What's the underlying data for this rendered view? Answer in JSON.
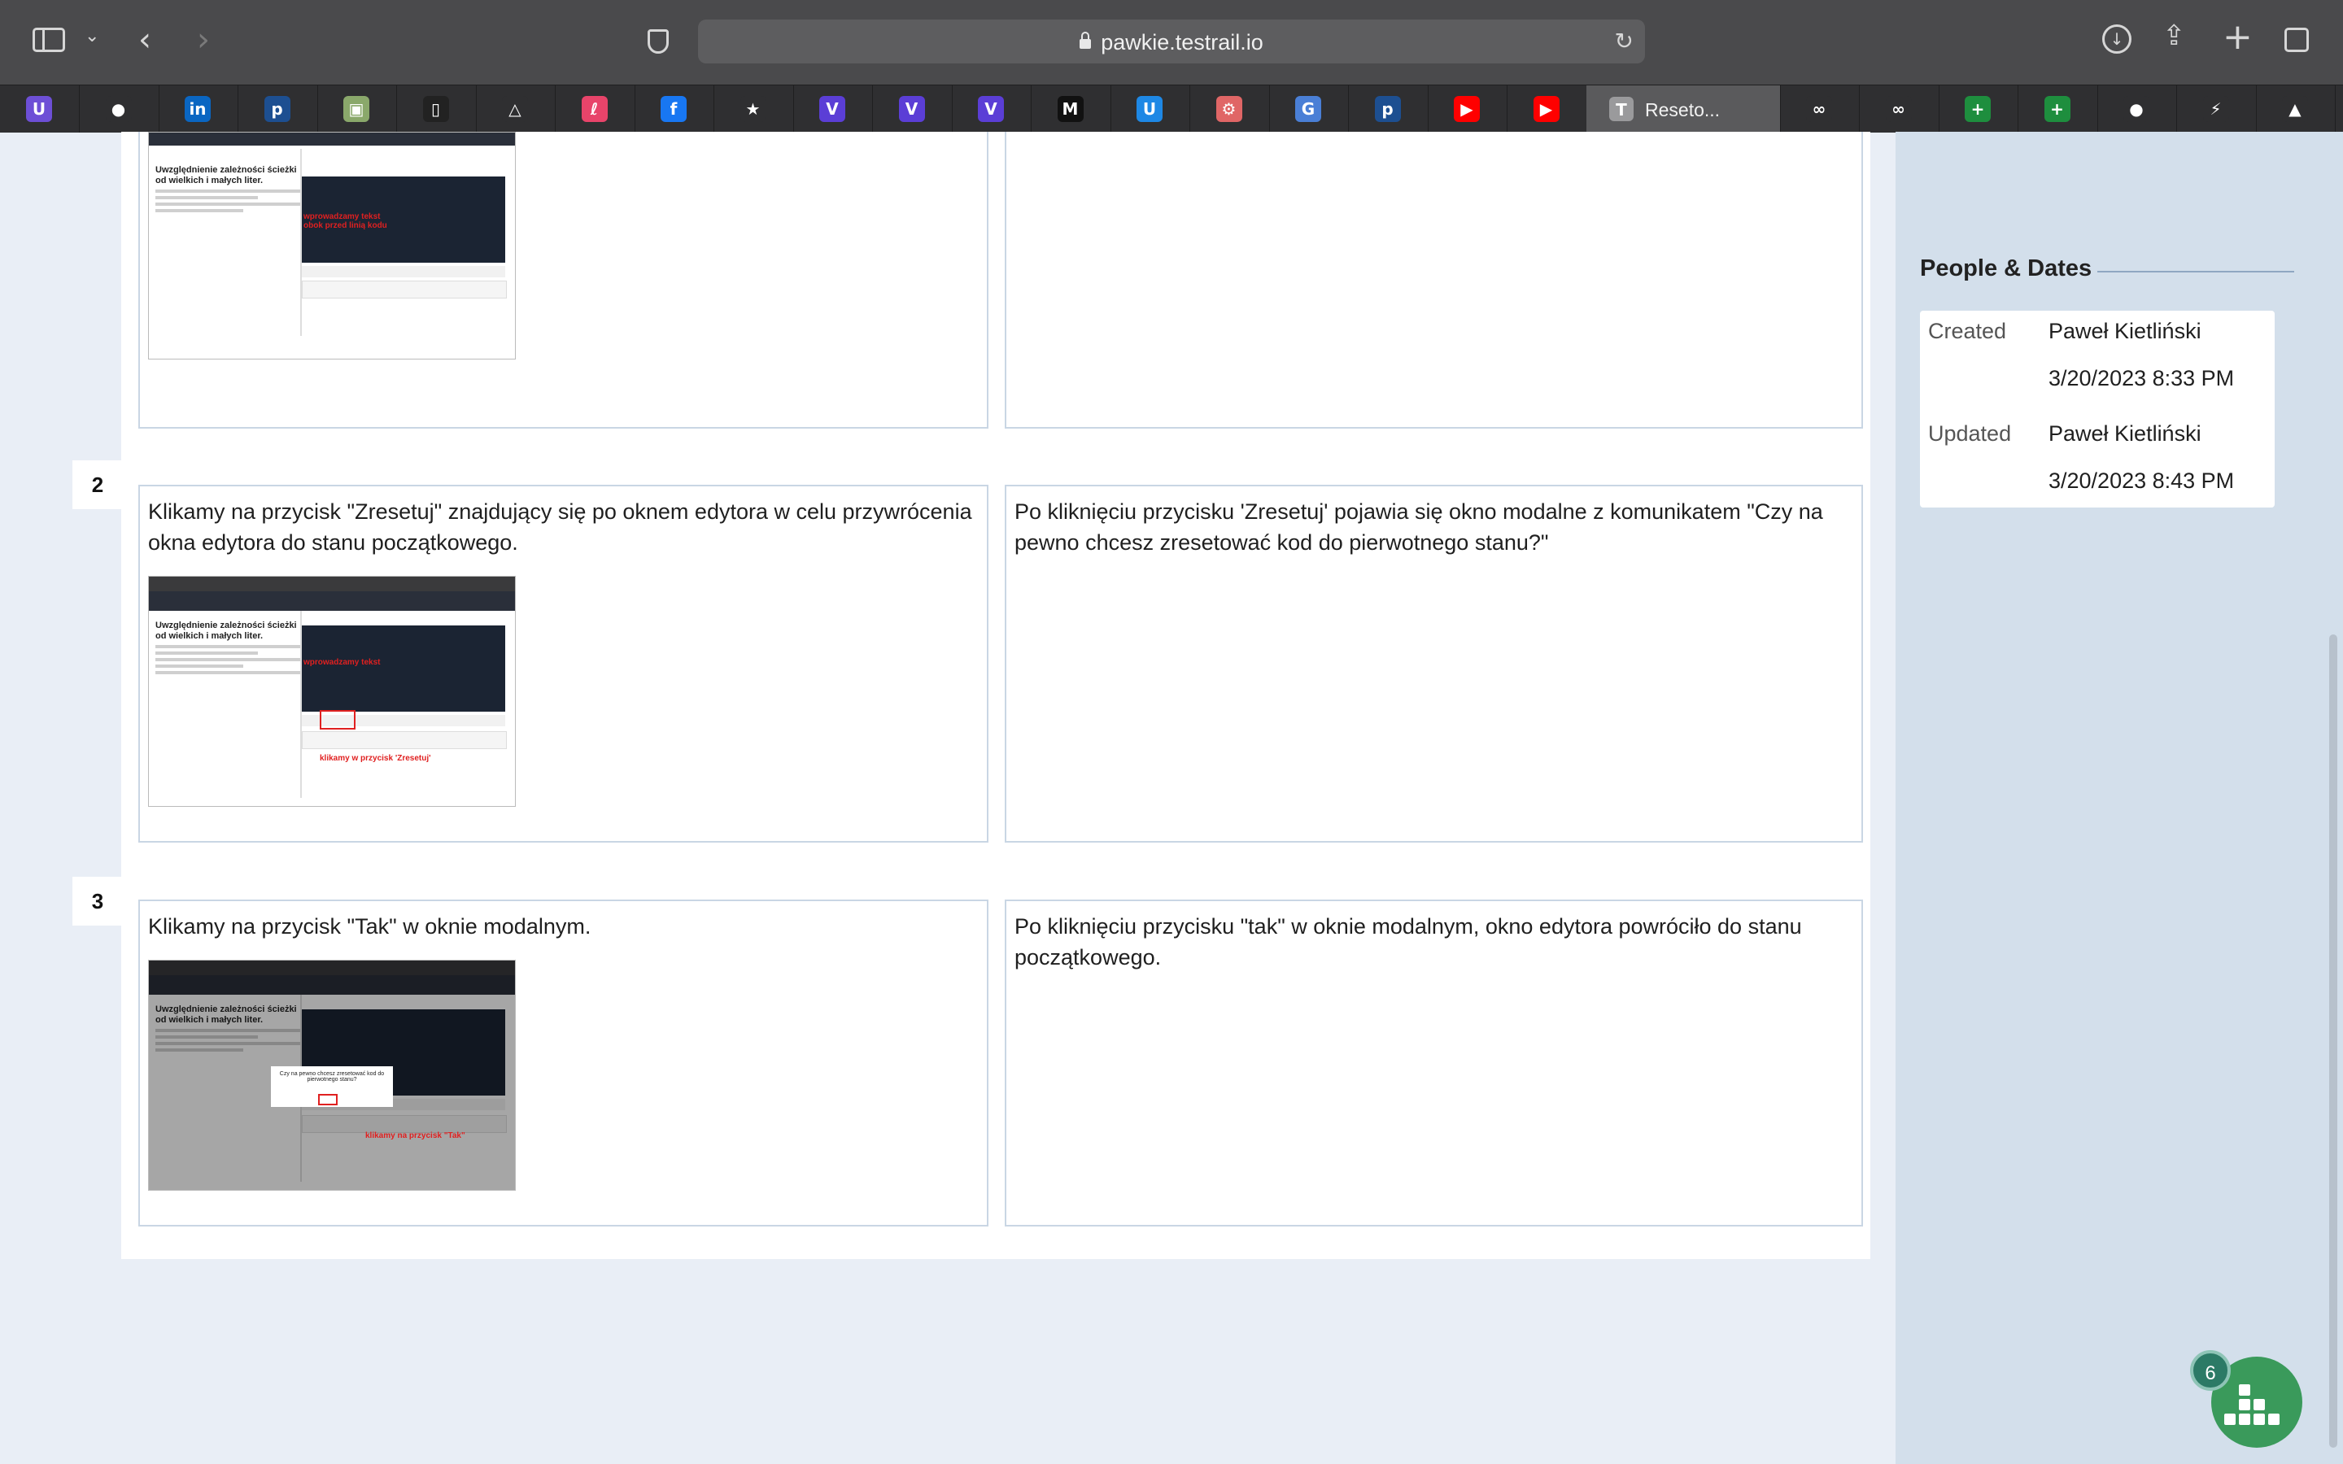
{
  "browser": {
    "url": "pawkie.testrail.io",
    "active_tab_title": "Reseto...",
    "tabs": [
      {
        "icon": "unlisted-icon",
        "color": "#6d4fd6",
        "glyph": "U"
      },
      {
        "icon": "elephant-icon",
        "color": "#2f2f31",
        "glyph": "●"
      },
      {
        "icon": "linkedin-icon",
        "color": "#0a66c2",
        "glyph": "in"
      },
      {
        "icon": "p-icon",
        "color": "#1d4f91",
        "glyph": "p"
      },
      {
        "icon": "photo-icon",
        "color": "#8aa86b",
        "glyph": "▣"
      },
      {
        "icon": "tablet-icon",
        "color": "#222222",
        "glyph": "▯"
      },
      {
        "icon": "triangle-icon",
        "color": "#2f2f31",
        "glyph": "△"
      },
      {
        "icon": "notion-icon",
        "color": "#e8446a",
        "glyph": "ℓ"
      },
      {
        "icon": "facebook-icon",
        "color": "#1877f2",
        "glyph": "f"
      },
      {
        "icon": "star-icon",
        "color": "#2f2f31",
        "glyph": "★"
      },
      {
        "icon": "shield-v-icon",
        "color": "#5b3ed6",
        "glyph": "V"
      },
      {
        "icon": "shield-v-icon",
        "color": "#5b3ed6",
        "glyph": "V"
      },
      {
        "icon": "shield-v-icon",
        "color": "#5b3ed6",
        "glyph": "V"
      },
      {
        "icon": "m-logo-icon",
        "color": "#111111",
        "glyph": "M"
      },
      {
        "icon": "u-circle-icon",
        "color": "#1e88e5",
        "glyph": "U"
      },
      {
        "icon": "openai-icon",
        "color": "#e06666",
        "glyph": "⚙"
      },
      {
        "icon": "translate-icon",
        "color": "#4a7fd6",
        "glyph": "G"
      },
      {
        "icon": "p-icon",
        "color": "#1d4f91",
        "glyph": "p"
      },
      {
        "icon": "youtube-icon",
        "color": "#ff0000",
        "glyph": "▶"
      },
      {
        "icon": "youtube-icon",
        "color": "#ff0000",
        "glyph": "▶"
      }
    ],
    "tabs_after": [
      {
        "icon": "infinity-icon",
        "color": "#2f2f31",
        "glyph": "∞"
      },
      {
        "icon": "infinity-icon",
        "color": "#2f2f31",
        "glyph": "∞"
      },
      {
        "icon": "sheets-plus-icon",
        "color": "#1e8e3e",
        "glyph": "+"
      },
      {
        "icon": "sheets-plus-icon",
        "color": "#1e8e3e",
        "glyph": "+"
      },
      {
        "icon": "bird-icon",
        "color": "#2f2f31",
        "glyph": "●"
      },
      {
        "icon": "bolt-icon",
        "color": "#2f2f31",
        "glyph": "⚡"
      },
      {
        "icon": "drive-icon",
        "color": "#2f2f31",
        "glyph": "▲"
      }
    ]
  },
  "steps": [
    {
      "number": "2",
      "action": "Klikamy na przycisk \"Zresetuj\" znajdujący się po oknem edytora w celu przywrócenia okna edytora do stanu początkowego.",
      "expected": "Po kliknięciu przycisku 'Zresetuj' pojawia się okno modalne z komunikatem \"Czy na pewno chcesz zresetować kod do pierwotnego stanu?\"",
      "thumb_note": "klikamy w przycisk 'Zresetuj'"
    },
    {
      "number": "3",
      "action": "Klikamy na przycisk \"Tak\" w oknie modalnym.",
      "expected": "Po kliknięciu przycisku \"tak\" w oknie modalnym, okno edytora powróciło do stanu początkowego.",
      "thumb_note": "klikamy na przycisk \"Tak\""
    }
  ],
  "thumb_common": {
    "heading": "Uwzględnienie zależności ścieżki od wielkich i małych liter.",
    "note_top": "wprowadzamy tekst obok przed linią kodu",
    "note_mid": "wprowadzamy tekst",
    "modal_text": "Czy na pewno chcesz zresetować kod do pierwotnego stanu?"
  },
  "sidebar": {
    "section_title": "People & Dates",
    "created_label": "Created",
    "created_by": "Paweł Kietliński",
    "created_date": "3/20/2023 8:33 PM",
    "updated_label": "Updated",
    "updated_by": "Paweł Kietliński",
    "updated_date": "3/20/2023 8:43 PM"
  },
  "fab": {
    "badge": "6"
  }
}
